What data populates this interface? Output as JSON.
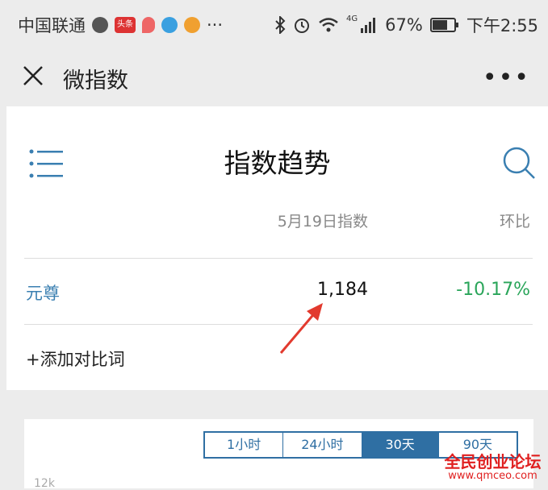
{
  "status_bar": {
    "carrier": "中国联通",
    "badge_text": "头条",
    "battery": "67%",
    "network": "4G",
    "time": "下午2:55"
  },
  "app_bar": {
    "title": "微指数",
    "more": "•••"
  },
  "page": {
    "title": "指数趋势",
    "col_date": "5月19日指数",
    "col_ratio": "环比",
    "keyword": "元尊",
    "index_value": "1,184",
    "ratio_value": "-10.17%",
    "add_compare": "+添加对比词"
  },
  "chart": {
    "tabs": [
      "1小时",
      "24小时",
      "30天",
      "90天"
    ],
    "active_tab": 2,
    "y_tick": "12k"
  },
  "watermark": {
    "name": "全民创业论坛",
    "url": "www.qmceo.com"
  },
  "colors": {
    "accent": "#2f6fa3",
    "keyword": "#3a7fb1",
    "positive_down": "#2aa55a",
    "annotation_arrow": "#e23a2e"
  }
}
